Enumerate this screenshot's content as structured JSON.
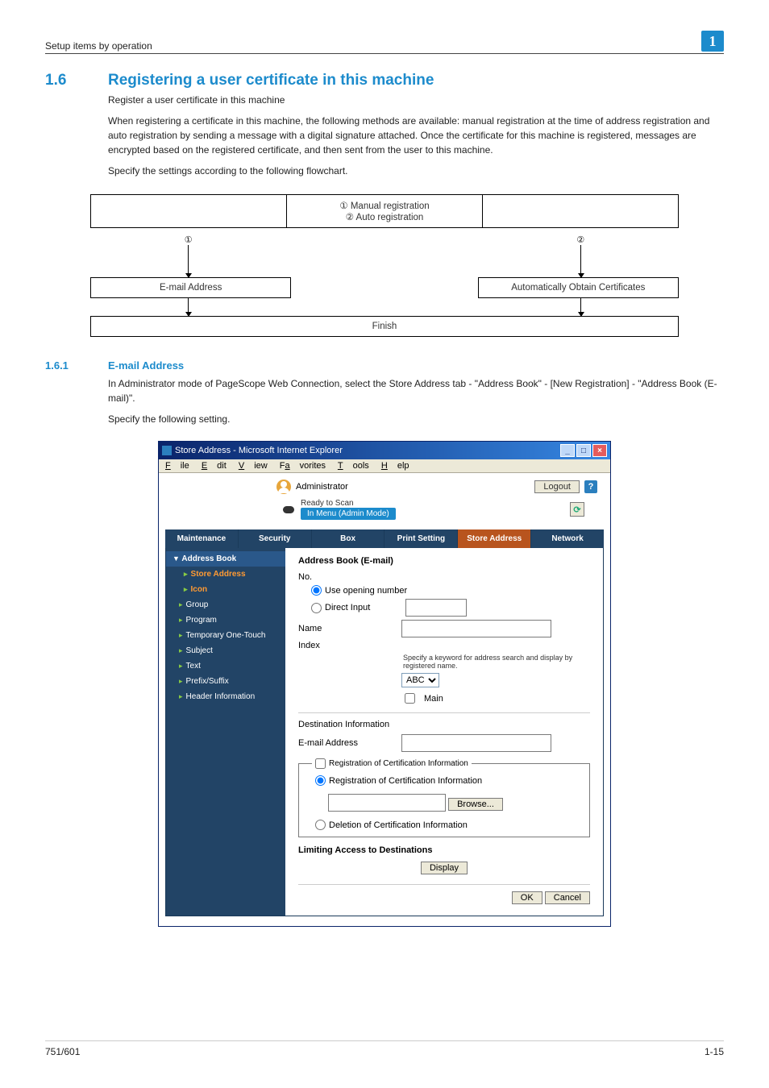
{
  "header": {
    "breadcrumb": "Setup items by operation",
    "chapter": "1"
  },
  "section": {
    "num": "1.6",
    "title": "Registering a user certificate in this machine"
  },
  "intro": {
    "l1": "Register a user certificate in this machine",
    "l2": "When registering a certificate in this machine, the following methods are available: manual registration at the time of address registration and auto registration by sending a message with a digital signature attached. Once the certificate for this machine is registered, messages are encrypted based on the registered certificate, and then sent from the user to this machine.",
    "l3": "Specify the settings according to the following flowchart."
  },
  "flow": {
    "manual": "① Manual registration",
    "auto": "② Auto registration",
    "n1": "①",
    "n2": "②",
    "email": "E-mail Address",
    "cert": "Automatically Obtain Certificates",
    "finish": "Finish"
  },
  "sub": {
    "num": "1.6.1",
    "title": "E-mail Address"
  },
  "body": {
    "l1": "In Administrator mode of PageScope Web Connection, select the Store Address tab - \"Address Book\" - [New Registration] - \"Address Book (E-mail)\".",
    "l2": "Specify the following setting."
  },
  "ie": {
    "title": "Store Address - Microsoft Internet Explorer",
    "menu": {
      "file": "File",
      "edit": "Edit",
      "view": "View",
      "fav": "Favorites",
      "tools": "Tools",
      "help": "Help"
    },
    "admin": "Administrator",
    "logout": "Logout",
    "help": "?",
    "ready": "Ready to Scan",
    "mode": "In Menu (Admin Mode)",
    "tabs": [
      "Maintenance",
      "Security",
      "Box",
      "Print Setting",
      "Store Address",
      "Network"
    ],
    "side": {
      "head": "Address Book",
      "items": [
        "Store Address",
        "Icon",
        "Group",
        "Program",
        "Temporary One-Touch",
        "Subject",
        "Text",
        "Prefix/Suffix",
        "Header Information"
      ]
    },
    "panel": {
      "title": "Address Book (E-mail)",
      "no": "No.",
      "useOpen": "Use opening number",
      "direct": "Direct Input",
      "name": "Name",
      "index": "Index",
      "note": "Specify a keyword for address search and display by registered name.",
      "abc": "ABC",
      "main": "Main",
      "dest": "Destination Information",
      "email": "E-mail Address",
      "regLegend": "Registration of Certification Information",
      "regOpt": "Registration of Certification Information",
      "browse": "Browse...",
      "delOpt": "Deletion of Certification Information",
      "limit": "Limiting Access to Destinations",
      "display": "Display",
      "ok": "OK",
      "cancel": "Cancel"
    }
  },
  "footer": {
    "left": "751/601",
    "right": "1-15"
  }
}
